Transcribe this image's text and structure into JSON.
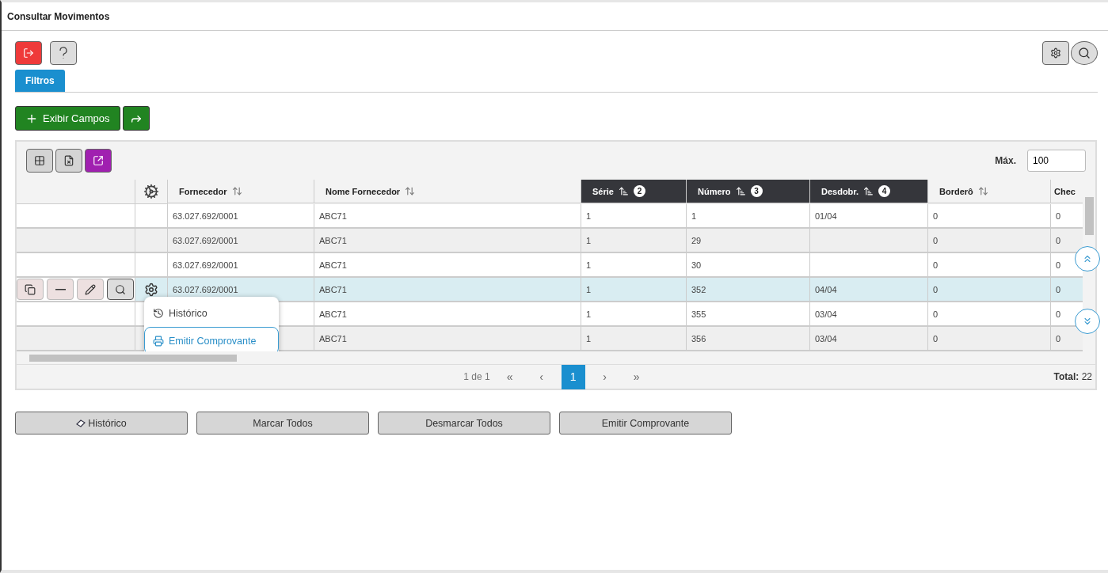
{
  "window": {
    "title": "Consultar Movimentos"
  },
  "tabs": [
    {
      "label": "Filtros",
      "selected": true
    }
  ],
  "show_fields_button": "Exibir Campos",
  "max": {
    "label": "Máx.",
    "value": "100"
  },
  "table": {
    "columns": [
      {
        "label": "Fornecedor",
        "active": false
      },
      {
        "label": "Nome Fornecedor",
        "active": false
      },
      {
        "label": "Série",
        "sort_order": "2",
        "active": true
      },
      {
        "label": "Número",
        "sort_order": "3",
        "active": true
      },
      {
        "label": "Desdobr.",
        "sort_order": "4",
        "active": true
      },
      {
        "label": "Borderô",
        "active": false
      },
      {
        "label": "Chec",
        "active": false
      }
    ],
    "rows": [
      {
        "selected": false,
        "cells": [
          "63.027.692/0001",
          "ABC71",
          "1",
          "1",
          "01/04",
          "0",
          "0"
        ]
      },
      {
        "selected": false,
        "cells": [
          "63.027.692/0001",
          "ABC71",
          "1",
          "29",
          "",
          "0",
          "0"
        ]
      },
      {
        "selected": false,
        "cells": [
          "63.027.692/0001",
          "ABC71",
          "1",
          "30",
          "",
          "0",
          "0"
        ]
      },
      {
        "selected": true,
        "cells": [
          "63.027.692/0001",
          "ABC71",
          "1",
          "352",
          "04/04",
          "0",
          "0"
        ]
      },
      {
        "selected": false,
        "cells": [
          "",
          "ABC71",
          "1",
          "355",
          "03/04",
          "0",
          "0"
        ]
      },
      {
        "selected": false,
        "cells": [
          "",
          "ABC71",
          "1",
          "356",
          "03/04",
          "0",
          "0"
        ]
      }
    ]
  },
  "row_menu": [
    {
      "label": "Histórico",
      "kind": "history",
      "selected": false
    },
    {
      "label": "Emitir Comprovante",
      "kind": "print",
      "selected": true
    }
  ],
  "pager": {
    "summary": "1 de 1",
    "first": "«",
    "prev": "‹",
    "pages": [
      {
        "label": "1",
        "selected": true
      }
    ],
    "next": "›",
    "last": "»",
    "total_label": "Total:",
    "total": "22"
  },
  "bottom_buttons": [
    {
      "label": "Histórico",
      "kind": "icon"
    },
    {
      "label": "Marcar Todos",
      "kind": "plain"
    },
    {
      "label": "Desmarcar Todos",
      "kind": "plain"
    },
    {
      "label": "Emitir Comprovante",
      "kind": "plain"
    }
  ]
}
